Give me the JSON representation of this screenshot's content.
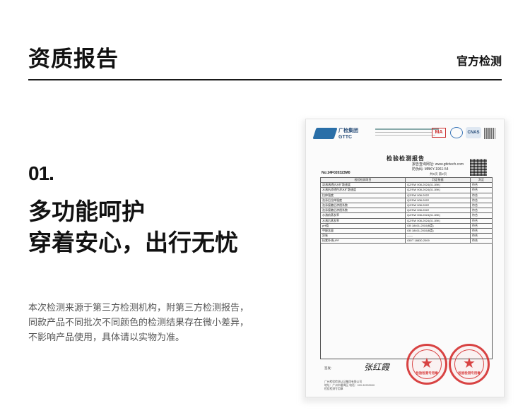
{
  "header": {
    "title": "资质报告",
    "tag": "官方检测"
  },
  "section": {
    "number": "01.",
    "headline": [
      "多功能呵护",
      "穿着安心，出行无忧"
    ],
    "disclaimer": [
      "本次检测来源于第三方检测机构，附第三方检测报告，",
      "同款产品不同批次不同颜色的检测结果存在微小差异，",
      "不影响产品使用，具体请以实物为准。"
    ]
  },
  "certificate": {
    "logo_text": "广检集团",
    "logo_sub": "GTTC",
    "ma_badge": "MA",
    "cnas_badge": "CNAS",
    "title": "检验检测报告",
    "meta": [
      "报告查询网址: www.gttctech.com",
      "防伪码: MBKY-1961-54"
    ],
    "report_no": "No:24F020323M0",
    "page": "共6页 第2页",
    "table_header": [
      "检验检测项目",
      "判定依据",
      "判定"
    ],
    "rows": [
      [
        "泼溅溅透抗水扩散速度",
        "QZ/SW 008-2024(31.1BK)",
        "符合"
      ],
      [
        "水溅抗渗透性渗水扩散速度",
        "QZ/SW 008-2024(31.1BK)",
        "符合"
      ],
      [
        "拉伸强度",
        "QZ/SW 008-2022",
        "符合"
      ],
      [
        "洗涤后拉伸强度",
        "QZ/SW 008-2022",
        "符合"
      ],
      [
        "洗涤接触后渗透系数",
        "QZ/SW 008-2022",
        "符合"
      ],
      [
        "洗涤接触后渗透系数",
        "QZ/SW 008-2022",
        "符合"
      ],
      [
        "水溅前蒸发率",
        "QZ/SW 008-2024(31.1BK)",
        "符合"
      ],
      [
        "水溅后蒸发率",
        "QZ/SW 008-2024(31.1BK)",
        "符合"
      ],
      [
        "pH值",
        "GB 18401-2010(B类)",
        "符合"
      ],
      [
        "甲醛含量",
        "GB 18401-2010(B类)",
        "符合"
      ],
      [
        "异味",
        "——",
        "符合"
      ],
      [
        "抗紫外线UPF",
        "GB/T 18830-2009",
        "符合"
      ]
    ],
    "sign_label": "签发:",
    "signature": "张红霞",
    "footer": [
      "广州检验检测认证集团有限公司",
      "地址：广州市番禺区 电话：020-32293000",
      "检验检测专用章"
    ],
    "seal_text": "检验检测专用章"
  },
  "colors": {
    "seal": "#d42a2a",
    "brand": "#2a6fa8"
  }
}
